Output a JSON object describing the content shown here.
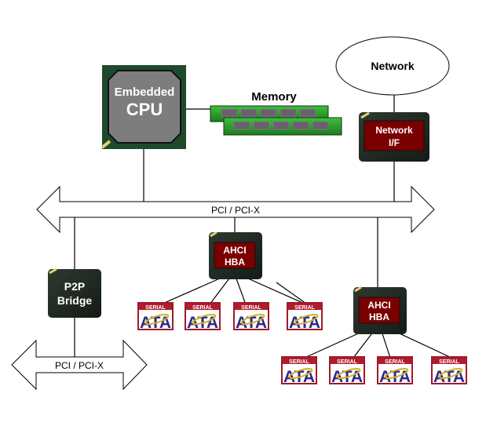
{
  "diagram": {
    "cpu": {
      "line1": "Embedded",
      "line2": "CPU"
    },
    "memory": {
      "label": "Memory"
    },
    "network": {
      "label": "Network"
    },
    "network_if": {
      "line1": "Network",
      "line2": "I/F"
    },
    "main_bus": {
      "label": "PCI / PCI-X"
    },
    "secondary_bus": {
      "label": "PCI / PCI-X"
    },
    "p2p_bridge": {
      "line1": "P2P",
      "line2": "Bridge"
    },
    "hba1": {
      "line1": "AHCI",
      "line2": "HBA"
    },
    "hba2": {
      "line1": "AHCI",
      "line2": "HBA"
    },
    "sata_logo": {
      "top": "SERIAL",
      "bottom": "ATA"
    },
    "colors": {
      "chip_dark": "#1f2a22",
      "chip_green": "#1e4a2c",
      "cpu_gray": "#7a7a7a",
      "label_red": "#7a0000",
      "memory_green": "#2f9a2f",
      "sata_red": "#b01c2e",
      "sata_blue": "#2a2a8a",
      "sata_gold": "#d4b020"
    }
  }
}
